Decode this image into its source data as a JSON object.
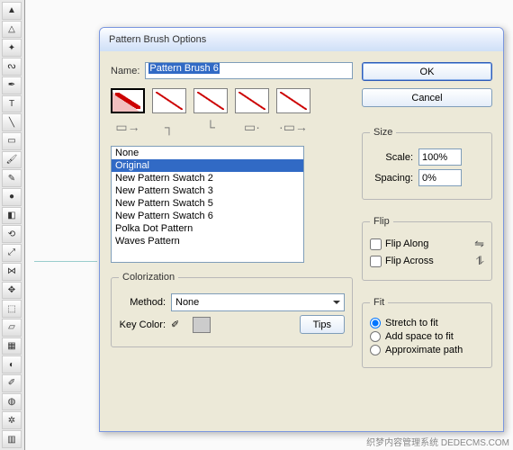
{
  "toolbar": {
    "tools": [
      "selection",
      "direct-select",
      "magic-wand",
      "lasso",
      "pen",
      "type",
      "line",
      "rectangle",
      "paintbrush",
      "pencil",
      "blob-brush",
      "eraser",
      "rotate",
      "scale",
      "width",
      "free-transform",
      "shape-builder",
      "perspective",
      "mesh",
      "gradient",
      "eyedropper",
      "blend",
      "symbol-sprayer",
      "column-graph",
      "artboard",
      "slice",
      "hand",
      "zoom"
    ]
  },
  "dialog": {
    "title": "Pattern Brush Options",
    "name_label": "Name:",
    "name_value": "Pattern Brush 6",
    "tile_labels": [
      "side",
      "outer-corner",
      "inner-corner",
      "start",
      "end"
    ],
    "swatches": [
      "None",
      "Original",
      "New Pattern Swatch 2",
      "New Pattern Swatch 3",
      "New Pattern Swatch 5",
      "New Pattern Swatch 6",
      "Polka Dot Pattern",
      "Waves Pattern"
    ],
    "selected_swatch_index": 1,
    "colorization": {
      "legend": "Colorization",
      "method_label": "Method:",
      "method_value": "None",
      "key_color_label": "Key Color:",
      "tips_label": "Tips"
    },
    "buttons": {
      "ok": "OK",
      "cancel": "Cancel"
    },
    "size": {
      "legend": "Size",
      "scale_label": "Scale:",
      "scale_value": "100%",
      "spacing_label": "Spacing:",
      "spacing_value": "0%"
    },
    "flip": {
      "legend": "Flip",
      "along_label": "Flip Along",
      "across_label": "Flip Across",
      "along_checked": false,
      "across_checked": false
    },
    "fit": {
      "legend": "Fit",
      "options": [
        "Stretch to fit",
        "Add space to fit",
        "Approximate path"
      ],
      "selected_index": 0
    }
  },
  "watermark": "织梦内容管理系统  DEDECMS.COM"
}
